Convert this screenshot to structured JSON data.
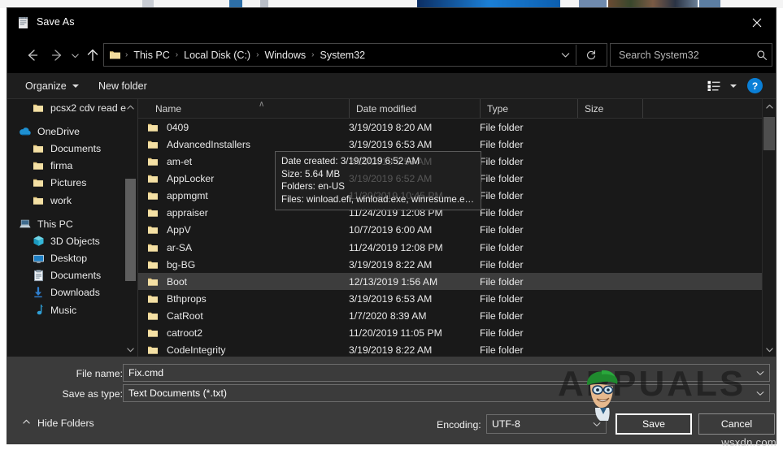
{
  "window": {
    "title": "Save As",
    "icon": "notepad-icon",
    "close_label": "✕"
  },
  "nav": {
    "back_icon": "arrow-left-icon",
    "forward_icon": "arrow-right-icon",
    "recent_icon": "chevron-down-icon",
    "up_icon": "arrow-up-icon",
    "refresh_icon": "refresh-icon",
    "address_dropdown_icon": "chevron-down-icon",
    "breadcrumbs": [
      "This PC",
      "Local Disk (C:)",
      "Windows",
      "System32"
    ],
    "separator": "›"
  },
  "search": {
    "placeholder": "Search System32",
    "value": "",
    "icon": "search-icon"
  },
  "toolbar": {
    "organize_label": "Organize",
    "new_folder_label": "New folder",
    "view_icon": "list-view-icon",
    "view_caret_icon": "chevron-down-icon",
    "help_label": "?"
  },
  "sidebar": {
    "scroll_up_icon": "chevron-up-icon",
    "scroll_down_icon": "chevron-down-icon",
    "items": [
      {
        "label": "pcsx2 cdv read e",
        "icon": "folder-icon",
        "level": 2,
        "truncated": true
      },
      {
        "label": "OneDrive",
        "icon": "onedrive-cloud-icon",
        "level": 1
      },
      {
        "label": "Documents",
        "icon": "folder-icon",
        "level": 2
      },
      {
        "label": "firma",
        "icon": "folder-icon",
        "level": 2
      },
      {
        "label": "Pictures",
        "icon": "folder-icon",
        "level": 2
      },
      {
        "label": "work",
        "icon": "folder-icon",
        "level": 2
      },
      {
        "label": "This PC",
        "icon": "this-pc-icon",
        "level": 1
      },
      {
        "label": "3D Objects",
        "icon": "3d-objects-icon",
        "level": 2
      },
      {
        "label": "Desktop",
        "icon": "desktop-icon",
        "level": 2
      },
      {
        "label": "Documents",
        "icon": "documents-icon",
        "level": 2
      },
      {
        "label": "Downloads",
        "icon": "downloads-icon",
        "level": 2
      },
      {
        "label": "Music",
        "icon": "music-icon",
        "level": 2
      }
    ]
  },
  "file_list": {
    "columns": [
      "Name",
      "Date modified",
      "Type",
      "Size"
    ],
    "sort_indicator": "∧",
    "sorted_column": "Name",
    "rows": [
      {
        "name": "0409",
        "date": "3/19/2019 8:20 AM",
        "type": "File folder",
        "size": "",
        "selected": false
      },
      {
        "name": "AdvancedInstallers",
        "date": "3/19/2019 6:53 AM",
        "type": "File folder",
        "size": "",
        "selected": false
      },
      {
        "name": "am-et",
        "date": "3/19/2019 6:53 AM",
        "type": "File folder",
        "size": "",
        "selected": false
      },
      {
        "name": "AppLocker",
        "date": "3/19/2019 6:52 AM",
        "type": "File folder",
        "size": "",
        "selected": false
      },
      {
        "name": "appmgmt",
        "date": "11/20/2019 10:45 PM",
        "type": "File folder",
        "size": "",
        "selected": false
      },
      {
        "name": "appraiser",
        "date": "11/24/2019 12:08 PM",
        "type": "File folder",
        "size": "",
        "selected": false
      },
      {
        "name": "AppV",
        "date": "10/7/2019 6:00 AM",
        "type": "File folder",
        "size": "",
        "selected": false
      },
      {
        "name": "ar-SA",
        "date": "11/24/2019 12:08 PM",
        "type": "File folder",
        "size": "",
        "selected": false
      },
      {
        "name": "bg-BG",
        "date": "3/19/2019 8:22 AM",
        "type": "File folder",
        "size": "",
        "selected": false
      },
      {
        "name": "Boot",
        "date": "12/13/2019 1:56 AM",
        "type": "File folder",
        "size": "",
        "selected": true
      },
      {
        "name": "Bthprops",
        "date": "3/19/2019 6:53 AM",
        "type": "File folder",
        "size": "",
        "selected": false
      },
      {
        "name": "CatRoot",
        "date": "1/7/2020 8:39 AM",
        "type": "File folder",
        "size": "",
        "selected": false
      },
      {
        "name": "catroot2",
        "date": "11/20/2019 11:05 PM",
        "type": "File folder",
        "size": "",
        "selected": false
      },
      {
        "name": "CodeIntegrity",
        "date": "3/19/2019 8:22 AM",
        "type": "File folder",
        "size": "",
        "selected": false
      }
    ],
    "scroll_up_icon": "chevron-up-icon",
    "scroll_down_icon": "chevron-down-icon"
  },
  "tooltip": {
    "lines": [
      "Date created: 3/19/2019 6:52 AM",
      "Size: 5.64 MB",
      "Folders: en-US",
      "Files: winload.efi, winload.exe, winresume.efi, ..."
    ]
  },
  "form": {
    "file_name_label": "File name:",
    "file_name_value": "Fix.cmd",
    "save_as_type_label": "Save as type:",
    "save_as_type_value": "Text Documents (*.txt)",
    "encoding_label": "Encoding:",
    "encoding_value": "UTF-8",
    "hide_folders_label": "Hide Folders",
    "hide_folders_icon": "chevron-up-icon",
    "save_label": "Save",
    "cancel_label": "Cancel",
    "dropdown_icon": "chevron-down-icon"
  },
  "watermarks": {
    "brand": "APPUALS",
    "site": "wsxdn.com"
  },
  "colors": {
    "titlebar": "#000000",
    "dialog_bg": "#2b2b2b",
    "list_bg": "#191919",
    "form_panel": "#3b3b3b",
    "selection": "#3d3d3d",
    "folder_icon": "#f6dfa0",
    "accent_blue": "#0a7fd6",
    "text": "#e8e8e8"
  }
}
